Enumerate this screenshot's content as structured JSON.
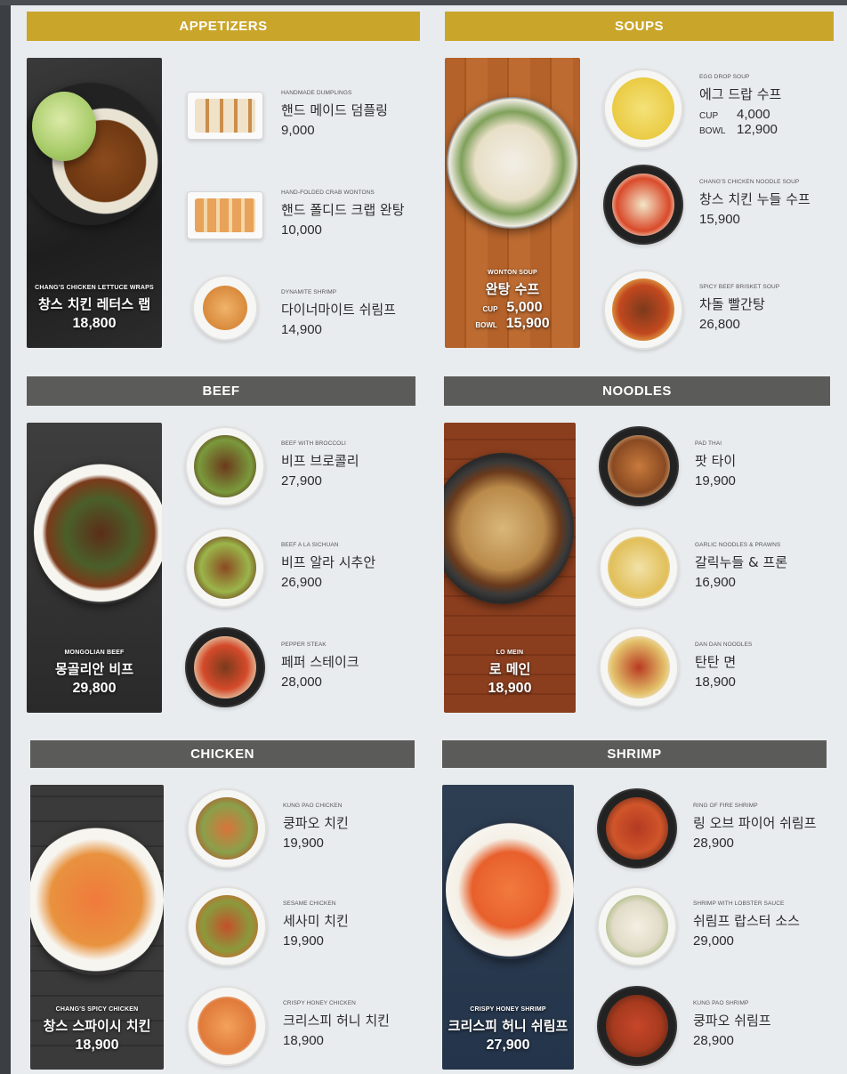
{
  "sections": {
    "appetizers": {
      "title": "APPETIZERS",
      "feature": {
        "en": "CHANG'S CHICKEN LETTUCE WRAPS",
        "ko": "창스 치킨 레터스 랩",
        "price": "18,800"
      },
      "items": [
        {
          "en": "HANDMADE DUMPLINGS",
          "ko": "핸드 메이드 덤플링",
          "price": "9,000"
        },
        {
          "en": "HAND-FOLDED CRAB WONTONS",
          "ko": "핸드 폴디드 크랩 완탕",
          "price": "10,000"
        },
        {
          "en": "DYNAMITE SHRIMP",
          "ko": "다이너마이트 쉬림프",
          "price": "14,900"
        }
      ]
    },
    "soups": {
      "title": "SOUPS",
      "feature": {
        "en": "WONTON SOUP",
        "ko": "완탕 수프",
        "cup_label": "CUP",
        "cup_price": "5,000",
        "bowl_label": "BOWL",
        "bowl_price": "15,900"
      },
      "items": [
        {
          "en": "EGG DROP SOUP",
          "ko": "에그 드랍 수프",
          "cup_label": "CUP",
          "cup_price": "4,000",
          "bowl_label": "BOWL",
          "bowl_price": "12,900"
        },
        {
          "en": "CHANG'S CHICKEN NOODLE SOUP",
          "ko": "창스 치킨 누들 수프",
          "price": "15,900"
        },
        {
          "en": "SPICY BEEF BRISKET SOUP",
          "ko": "차돌 빨간탕",
          "price": "26,800"
        }
      ]
    },
    "beef": {
      "title": "BEEF",
      "feature": {
        "en": "MONGOLIAN BEEF",
        "ko": "몽골리안 비프",
        "price": "29,800"
      },
      "items": [
        {
          "en": "BEEF WITH BROCCOLI",
          "ko": "비프 브로콜리",
          "price": "27,900"
        },
        {
          "en": "BEEF A LA SICHUAN",
          "ko": "비프 알라 시추안",
          "price": "26,900"
        },
        {
          "en": "PEPPER STEAK",
          "ko": "페퍼 스테이크",
          "price": "28,000"
        }
      ]
    },
    "noodles": {
      "title": "NOODLES",
      "feature": {
        "en": "LO MEIN",
        "ko": "로 메인",
        "price": "18,900"
      },
      "items": [
        {
          "en": "PAD THAI",
          "ko": "팟 타이",
          "price": "19,900"
        },
        {
          "en": "GARLIC NOODLES & PRAWNS",
          "ko": "갈릭누들 & 프론",
          "price": "16,900"
        },
        {
          "en": "DAN DAN NOODLES",
          "ko": "탄탄 면",
          "price": "18,900"
        }
      ]
    },
    "chicken": {
      "title": "CHICKEN",
      "feature": {
        "en": "CHANG'S SPICY CHICKEN",
        "ko": "창스 스파이시 치킨",
        "price": "18,900"
      },
      "items": [
        {
          "en": "KUNG PAO CHICKEN",
          "ko": "쿵파오 치킨",
          "price": "19,900"
        },
        {
          "en": "SESAME CHICKEN",
          "ko": "세사미 치킨",
          "price": "19,900"
        },
        {
          "en": "CRISPY HONEY CHICKEN",
          "ko": "크리스피 허니 치킨",
          "price": "18,900"
        }
      ]
    },
    "shrimp": {
      "title": "SHRIMP",
      "feature": {
        "en": "CRISPY HONEY SHRIMP",
        "ko": "크리스피 허니 쉬림프",
        "price": "27,900"
      },
      "items": [
        {
          "en": "RING OF FIRE SHRIMP",
          "ko": "링 오브 파이어 쉬림프",
          "price": "28,900"
        },
        {
          "en": "SHRIMP WITH LOBSTER SAUCE",
          "ko": "쉬림프 랍스터 소스",
          "price": "29,000"
        },
        {
          "en": "KUNG PAO SHRIMP",
          "ko": "쿵파오 쉬림프",
          "price": "28,900"
        }
      ]
    }
  },
  "colors": {
    "banner_gold": "#c9a52a",
    "banner_gray": "#5b5c59",
    "background": "#e9ecef"
  }
}
